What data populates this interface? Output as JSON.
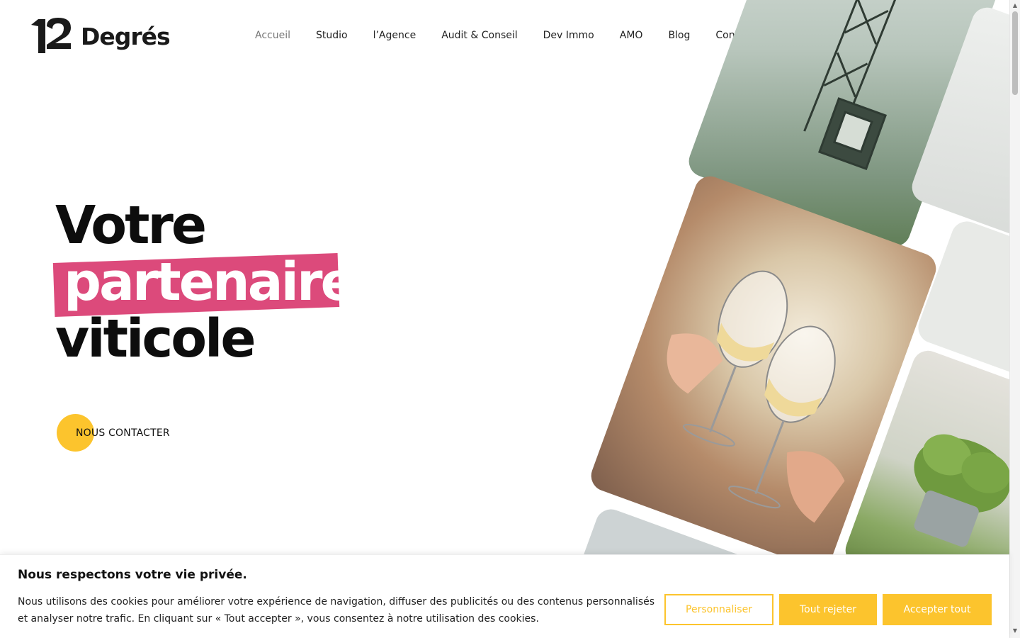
{
  "brand": {
    "logo_word": "Degrés",
    "accent_color": "#dc4a7b",
    "cta_color": "#fcc42d"
  },
  "nav": {
    "items": [
      {
        "label": "Accueil",
        "active": true
      },
      {
        "label": "Studio",
        "active": false
      },
      {
        "label": "l’Agence",
        "active": false
      },
      {
        "label": "Audit & Conseil",
        "active": false
      },
      {
        "label": "Dev Immo",
        "active": false
      },
      {
        "label": "AMO",
        "active": false
      },
      {
        "label": "Blog",
        "active": false
      },
      {
        "label": "Contact",
        "active": false
      }
    ],
    "social": [
      "instagram-icon",
      "linkedin-icon"
    ]
  },
  "hero": {
    "line1": "Votre",
    "line2": "partenaire",
    "line3": "viticole",
    "cta_label": "NOUS CONTACTER"
  },
  "collage": {
    "tiles": [
      "crane-photo",
      "wine-toast-photo",
      "interior-photo",
      "wall-photo",
      "plant-photo",
      "building-photo"
    ]
  },
  "cookie": {
    "title": "Nous respectons votre vie privée.",
    "text": "Nous utilisons des cookies pour améliorer votre expérience de navigation, diffuser des publicités ou des contenus personnalisés et analyser notre trafic. En cliquant sur « Tout accepter », vous consentez à notre utilisation des cookies.",
    "customize_label": "Personnaliser",
    "reject_label": "Tout rejeter",
    "accept_label": "Accepter tout"
  }
}
